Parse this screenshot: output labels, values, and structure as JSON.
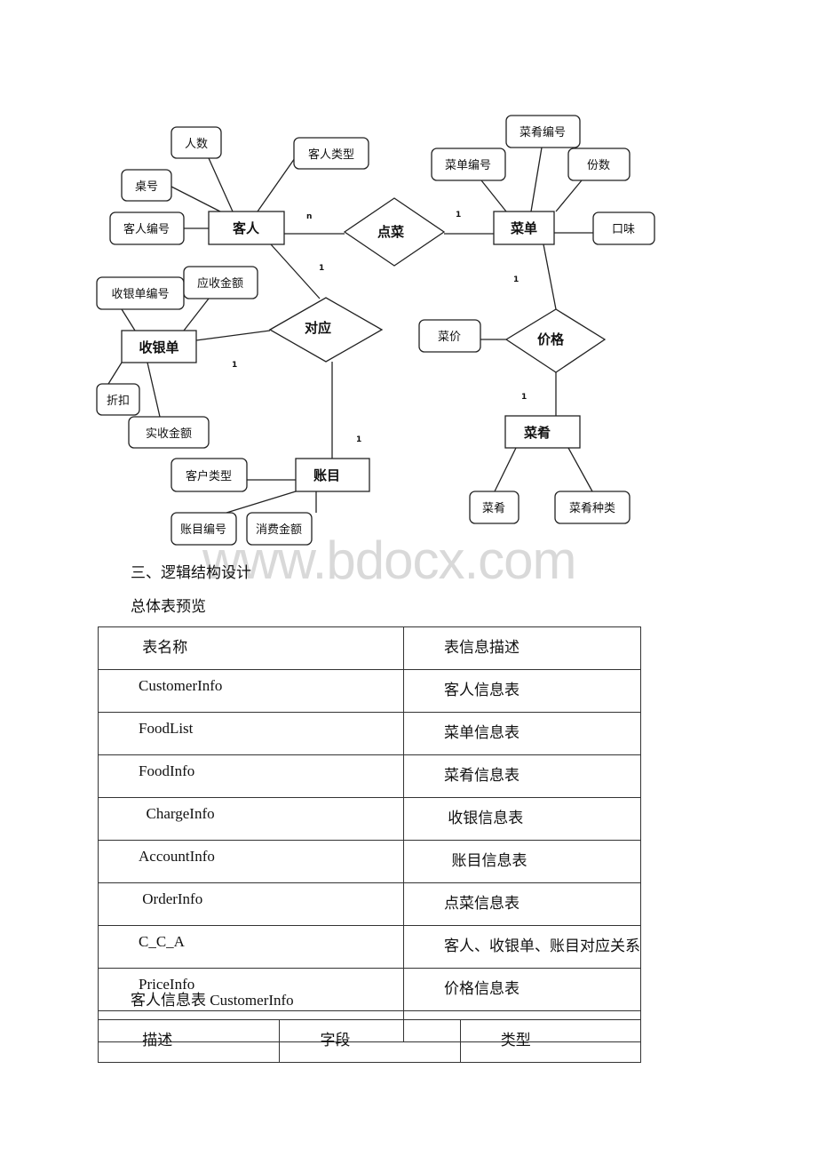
{
  "er_diagram": {
    "entities": {
      "customer": "客人",
      "menu": "菜单",
      "cashier": "收银单",
      "dish": "菜肴",
      "account": "账目"
    },
    "relationships": {
      "order": "点菜",
      "correspond": "对应",
      "price": "价格"
    },
    "attributes": {
      "people_count": "人数",
      "customer_type": "客人类型",
      "table_no": "桌号",
      "customer_id": "客人编号",
      "dish_id": "菜肴编号",
      "menu_id": "菜单编号",
      "portions": "份数",
      "taste": "口味",
      "cashier_id": "收银单编号",
      "receivable": "应收金额",
      "dish_price": "菜价",
      "discount": "折扣",
      "received": "实收金额",
      "client_type": "客户类型",
      "account_id": "账目编号",
      "consumption": "消费金额",
      "dish_name": "菜肴",
      "dish_category": "菜肴种类"
    },
    "cardinalities": [
      "n",
      "1",
      "1",
      "1",
      "1",
      "1",
      "1"
    ]
  },
  "watermark": "www.bdocx.com",
  "section_heading": "三、逻辑结构设计",
  "overview_label": "总体表预览",
  "overview_table": {
    "headers": [
      " 表名称",
      "表信息描述"
    ],
    "rows": [
      [
        "CustomerInfo",
        "客人信息表"
      ],
      [
        "FoodList",
        "菜单信息表"
      ],
      [
        "FoodInfo",
        "菜肴信息表"
      ],
      [
        "  ChargeInfo",
        " 收银信息表"
      ],
      [
        "AccountInfo",
        "  账目信息表"
      ],
      [
        " OrderInfo",
        "点菜信息表"
      ],
      [
        "C_C_A",
        "客人、收银单、账目对应关系"
      ],
      [
        "PriceInfo",
        "价格信息表"
      ],
      [
        "",
        ""
      ]
    ]
  },
  "customer_table_label": "客人信息表 CustomerInfo",
  "customer_table": {
    "headers": [
      " 描述",
      "字段",
      "类型"
    ]
  }
}
